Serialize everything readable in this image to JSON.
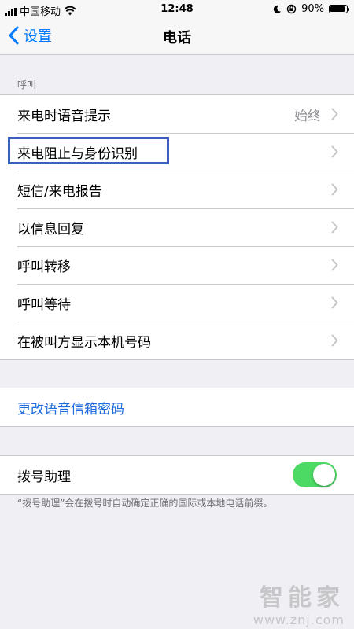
{
  "status_bar": {
    "carrier": "中国移动",
    "time": "12:48",
    "battery_percent": "90%",
    "battery_level": 0.9
  },
  "nav": {
    "back_label": "设置",
    "title": "电话"
  },
  "calls_section": {
    "header": "呼叫",
    "rows": [
      {
        "label": "来电时语音提示",
        "value": "始终"
      },
      {
        "label": "来电阻止与身份识别"
      },
      {
        "label": "短信/来电报告"
      },
      {
        "label": "以信息回复"
      },
      {
        "label": "呼叫转移"
      },
      {
        "label": "呼叫等待"
      },
      {
        "label": "在被叫方显示本机号码"
      }
    ]
  },
  "voicemail": {
    "change_password_label": "更改语音信箱密码"
  },
  "dial_assist": {
    "label": "拨号助理",
    "enabled": true,
    "footer": "“拨号助理”会在拨号时自动确定正确的国际或本地电话前缀。"
  },
  "watermark": {
    "logo": "智能家",
    "url": "www.znj.com"
  },
  "colors": {
    "accent": "#007aff",
    "link": "#1f6ddc",
    "toggle_on": "#4cd964",
    "highlight_box": "#3a5fbf",
    "background": "#efeff4"
  },
  "icons": [
    "signal-bars-icon",
    "wifi-icon",
    "moon-icon",
    "rotation-lock-icon",
    "battery-icon",
    "chevron-left-icon",
    "chevron-right-icon"
  ]
}
